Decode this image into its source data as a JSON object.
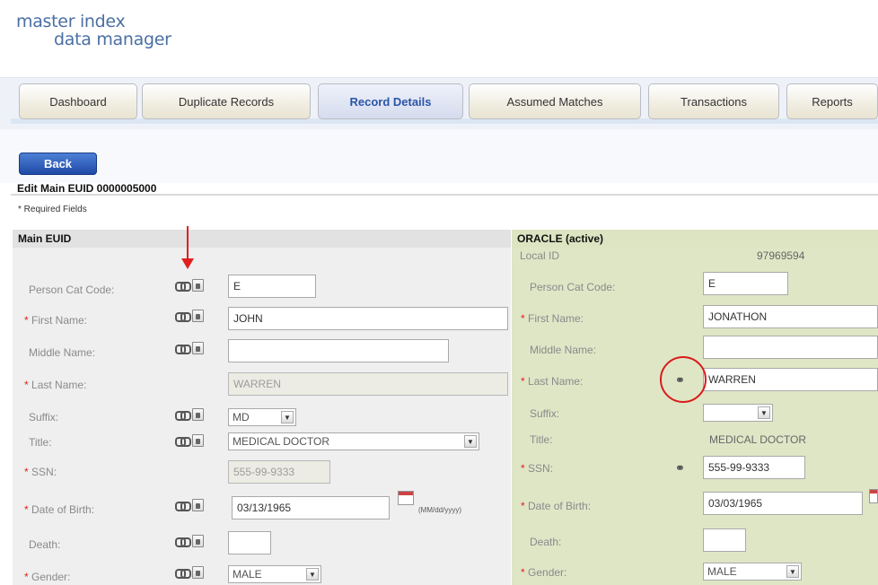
{
  "logo": {
    "line1": "master index",
    "line2": "data manager"
  },
  "tabs": [
    {
      "label": "Dashboard"
    },
    {
      "label": "Duplicate Records"
    },
    {
      "label": "Record Details",
      "active": true
    },
    {
      "label": "Assumed Matches"
    },
    {
      "label": "Transactions"
    },
    {
      "label": "Reports"
    }
  ],
  "back_label": "Back",
  "edit_title": "Edit Main EUID 0000005000",
  "required_note": "* Required Fields",
  "left_panel": {
    "title": "Main EUID",
    "fields": {
      "person_cat_code": {
        "label": "Person Cat Code:",
        "value": "E"
      },
      "first_name": {
        "label": "First Name:",
        "value": "JOHN"
      },
      "middle_name": {
        "label": "Middle Name:",
        "value": ""
      },
      "last_name": {
        "label": "Last Name:",
        "value": "WARREN"
      },
      "suffix": {
        "label": "Suffix:",
        "value": "MD"
      },
      "title": {
        "label": "Title:",
        "value": "MEDICAL DOCTOR"
      },
      "ssn": {
        "label": "SSN:",
        "value": "555-99-9333"
      },
      "dob": {
        "label": "Date of Birth:",
        "value": "03/13/1965",
        "hint": "(MM/dd/yyyy)"
      },
      "death": {
        "label": "Death:",
        "value": ""
      },
      "gender": {
        "label": "Gender:",
        "value": "MALE"
      }
    }
  },
  "right_panel": {
    "title": "ORACLE (active)",
    "local_id_label": "Local ID",
    "local_id_value": "97969594",
    "fields": {
      "person_cat_code": {
        "label": "Person Cat Code:",
        "value": "E"
      },
      "first_name": {
        "label": "First Name:",
        "value": "JONATHON"
      },
      "middle_name": {
        "label": "Middle Name:",
        "value": ""
      },
      "last_name": {
        "label": "Last Name:",
        "value": "WARREN"
      },
      "suffix": {
        "label": "Suffix:",
        "value": ""
      },
      "title": {
        "label": "Title:",
        "value": "MEDICAL DOCTOR"
      },
      "ssn": {
        "label": "SSN:",
        "value": "555-99-9333"
      },
      "dob": {
        "label": "Date of Birth:",
        "value": "03/03/1965"
      },
      "death": {
        "label": "Death:",
        "value": ""
      },
      "gender": {
        "label": "Gender:",
        "value": "MALE"
      }
    }
  },
  "colors": {
    "accent_blue": "#2b55a8",
    "highlight_red": "#e02020",
    "right_panel_bg": "#dfe6c6"
  }
}
